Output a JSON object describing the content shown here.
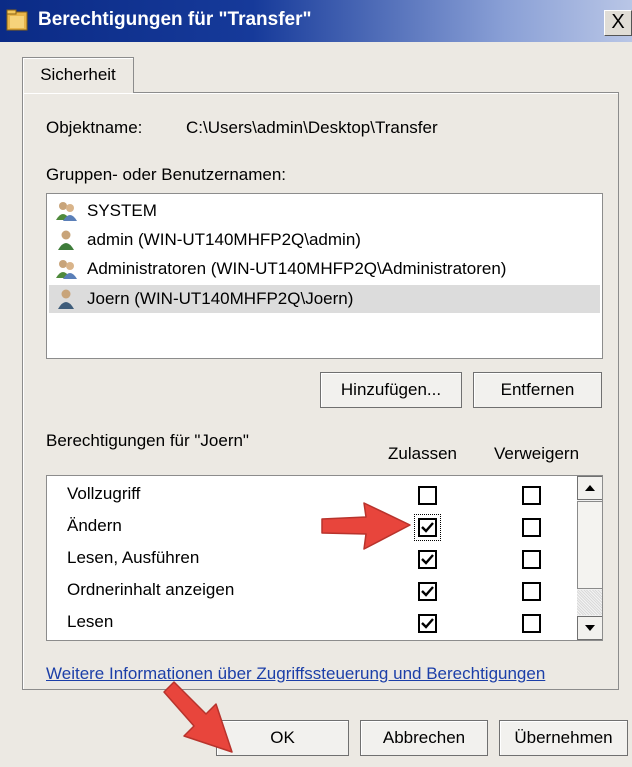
{
  "window": {
    "title": "Berechtigungen für \"Transfer\"",
    "close_glyph": "X"
  },
  "tabs": [
    {
      "label": "Sicherheit",
      "active": true
    }
  ],
  "object": {
    "label": "Objektname:",
    "value": "C:\\Users\\admin\\Desktop\\Transfer"
  },
  "groups": {
    "label": "Gruppen- oder Benutzernamen:",
    "items": [
      {
        "name": "SYSTEM",
        "icon": "group-icon",
        "selected": false
      },
      {
        "name": "admin (WIN-UT140MHFP2Q\\admin)",
        "icon": "user-icon",
        "selected": false
      },
      {
        "name": "Administratoren (WIN-UT140MHFP2Q\\Administratoren)",
        "icon": "group-icon",
        "selected": false
      },
      {
        "name": "Joern (WIN-UT140MHFP2Q\\Joern)",
        "icon": "user-icon",
        "selected": true
      }
    ],
    "add_button": "Hinzufügen...",
    "remove_button": "Entfernen"
  },
  "permissions": {
    "label": "Berechtigungen für \"Joern\"",
    "allow_header": "Zulassen",
    "deny_header": "Verweigern",
    "items": [
      {
        "name": "Vollzugriff",
        "allow": false,
        "deny": false
      },
      {
        "name": "Ändern",
        "allow": true,
        "deny": false,
        "focused": true
      },
      {
        "name": "Lesen, Ausführen",
        "allow": true,
        "deny": false
      },
      {
        "name": "Ordnerinhalt anzeigen",
        "allow": true,
        "deny": false
      },
      {
        "name": "Lesen",
        "allow": true,
        "deny": false
      }
    ]
  },
  "link": "Weitere Informationen über Zugriffssteuerung und Berechtigungen",
  "buttons": {
    "ok": "OK",
    "cancel": "Abbrechen",
    "apply": "Übernehmen"
  },
  "colors": {
    "annotation_arrow": "#e8453c",
    "title_bar": "#0b2b86",
    "link": "#1c3fa8"
  }
}
